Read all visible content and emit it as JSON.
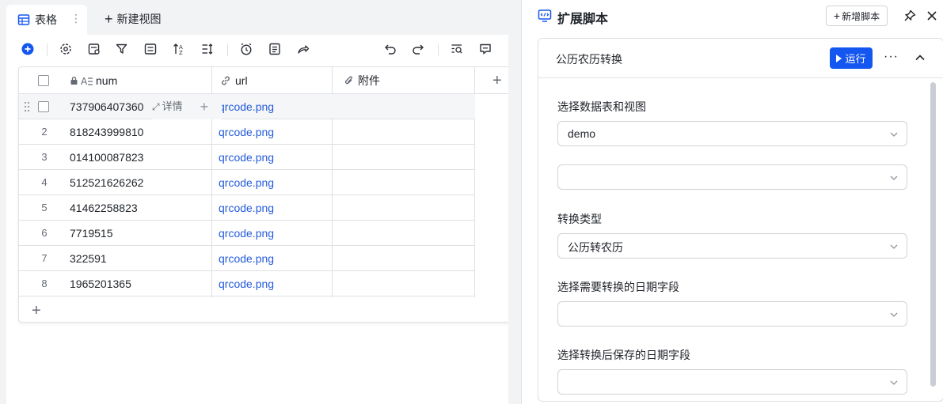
{
  "table_view": {
    "tab_label": "表格",
    "tab_more": "⋮",
    "new_view_label": "新建视图",
    "columns": {
      "num": "num",
      "url": "url",
      "attachment": "附件"
    },
    "detail_label": "详情",
    "rows": [
      {
        "index": "",
        "num": "737906407360",
        "url": "qrcode.png"
      },
      {
        "index": "2",
        "num": "818243999810",
        "url": "qrcode.png"
      },
      {
        "index": "3",
        "num": "014100087823",
        "url": "qrcode.png"
      },
      {
        "index": "4",
        "num": "512521626262",
        "url": "qrcode.png"
      },
      {
        "index": "5",
        "num": "41462258823",
        "url": "qrcode.png"
      },
      {
        "index": "6",
        "num": "7719515",
        "url": "qrcode.png"
      },
      {
        "index": "7",
        "num": "322591",
        "url": "qrcode.png"
      },
      {
        "index": "8",
        "num": "1965201365",
        "url": "qrcode.png"
      }
    ],
    "toolbar_icons": [
      "add-icon",
      "settings-icon",
      "field-icon",
      "filter-icon",
      "group-icon",
      "sort-icon",
      "row-height-icon",
      "alarm-icon",
      "form-icon",
      "share-icon",
      "undo-icon",
      "redo-icon",
      "search-icon",
      "comment-icon"
    ]
  },
  "panel": {
    "title": "扩展脚本",
    "add_script_label": "新增脚本",
    "card": {
      "title": "公历农历转换",
      "run_label": "运行",
      "more": "···",
      "fields": [
        {
          "label": "选择数据表和视图",
          "value": "demo"
        },
        {
          "label": "",
          "value": ""
        },
        {
          "label": "转换类型",
          "value": "公历转农历"
        },
        {
          "label": "选择需要转换的日期字段",
          "value": ""
        },
        {
          "label": "选择转换后保存的日期字段",
          "value": ""
        }
      ]
    }
  },
  "colors": {
    "accent": "#1456f0",
    "link": "#245bdb",
    "border": "#dee0e3"
  }
}
